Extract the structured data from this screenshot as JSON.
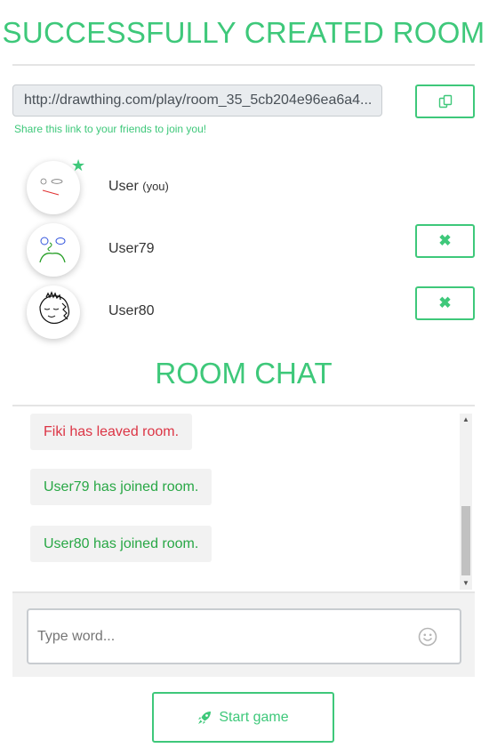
{
  "header": {
    "title": "SUCCESSFULLY CREATED ROOM"
  },
  "share": {
    "link": "http://drawthing.com/play/room_35_5cb204e96ea6a4...",
    "hint": "Share this link to your friends to join you!"
  },
  "players": [
    {
      "name": "User",
      "tag": "(you)",
      "owner": true
    },
    {
      "name": "User79"
    },
    {
      "name": "User80"
    }
  ],
  "chat": {
    "title": "ROOM CHAT",
    "messages": [
      {
        "text": "Fiki has leaved room.",
        "kind": "leave"
      },
      {
        "text": "User79 has joined room.",
        "kind": "join"
      },
      {
        "text": "User80 has joined room.",
        "kind": "join"
      }
    ],
    "input_placeholder": "Type word..."
  },
  "actions": {
    "start_label": "Start game"
  },
  "icons": {
    "copy": "copy-icon",
    "kick": "close-icon",
    "owner": "star-icon",
    "emoji": "smiley-icon",
    "start": "rocket-icon"
  },
  "colors": {
    "accent": "#3ec87a",
    "leave": "#dc3545",
    "join": "#28a745"
  }
}
